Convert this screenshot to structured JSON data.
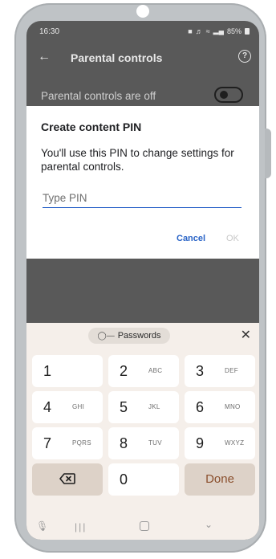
{
  "status_bar": {
    "time": "16:30",
    "icons": [
      "alarm-icon",
      "mute-icon",
      "wifi-icon",
      "volte-icon",
      "signal-icon"
    ],
    "battery": "85%"
  },
  "app_bar": {
    "title": "Parental controls",
    "back_icon": "arrow-back-icon",
    "help_icon": "help-icon"
  },
  "setting": {
    "label": "Parental controls are off",
    "toggle_on": false
  },
  "dialog": {
    "title": "Create content PIN",
    "body": "You'll use this PIN to change settings for parental controls.",
    "input_placeholder": "Type PIN",
    "input_value": "",
    "cancel_label": "Cancel",
    "ok_label": "OK"
  },
  "keyboard": {
    "chip_label": "Passwords",
    "chip_icon": "key-icon",
    "close_icon": "close-icon",
    "keys": [
      {
        "main": "1",
        "letters": ""
      },
      {
        "main": "2",
        "letters": "ABC"
      },
      {
        "main": "3",
        "letters": "DEF"
      },
      {
        "main": "4",
        "letters": "GHI"
      },
      {
        "main": "5",
        "letters": "JKL"
      },
      {
        "main": "6",
        "letters": "MNO"
      },
      {
        "main": "7",
        "letters": "PQRS"
      },
      {
        "main": "8",
        "letters": "TUV"
      },
      {
        "main": "9",
        "letters": "WXYZ"
      },
      {
        "main": "0",
        "letters": ""
      }
    ],
    "done_label": "Done",
    "backspace_icon": "backspace-icon"
  },
  "nav_bar": {
    "mic_icon": "microphone-icon",
    "recents_icon": "recents-icon",
    "home_icon": "home-icon",
    "back_icon": "nav-back-chevron-icon"
  },
  "colors": {
    "accent_blue": "#2a64c7",
    "done_text": "#8a4f2d",
    "keyboard_bg": "#f5efea",
    "scrim": "#595959"
  }
}
